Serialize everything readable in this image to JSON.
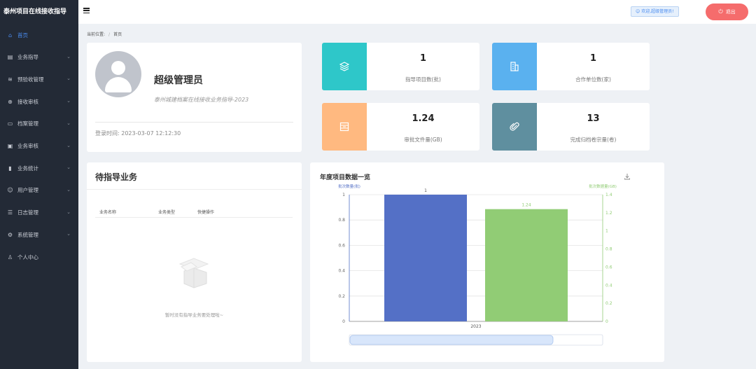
{
  "app": {
    "title": "泰州项目在线接收指导"
  },
  "sidebar": {
    "items": [
      {
        "label": "首页",
        "icon": "home-icon",
        "has_submenu": false,
        "active": true
      },
      {
        "label": "业务指导",
        "icon": "document-icon",
        "has_submenu": true
      },
      {
        "label": "预验收管理",
        "icon": "layers-icon",
        "has_submenu": true
      },
      {
        "label": "接收审核",
        "icon": "globe-icon",
        "has_submenu": true
      },
      {
        "label": "档案管理",
        "icon": "folder-icon",
        "has_submenu": true
      },
      {
        "label": "业务审核",
        "icon": "file-check-icon",
        "has_submenu": true
      },
      {
        "label": "业务统计",
        "icon": "bar-chart-icon",
        "has_submenu": true
      },
      {
        "label": "用户管理",
        "icon": "users-icon",
        "has_submenu": true
      },
      {
        "label": "日志管理",
        "icon": "log-icon",
        "has_submenu": true
      },
      {
        "label": "系统管理",
        "icon": "gear-icon",
        "has_submenu": true
      },
      {
        "label": "个人中心",
        "icon": "user-icon",
        "has_submenu": false
      }
    ]
  },
  "header": {
    "welcome": "欢迎,超级管理员!",
    "logout": "退出"
  },
  "breadcrumb": {
    "label": "当前位置:",
    "sep": "/",
    "current": "首页"
  },
  "profile": {
    "name": "超级管理员",
    "org": "泰州城建档案在线接收业务指导-2023",
    "login_time": "登录时间: 2023-03-07 12:12:30"
  },
  "stats": [
    {
      "value": "1",
      "label": "指导项目数(批)",
      "color": "#2ec7c9",
      "icon": "layers-icon"
    },
    {
      "value": "1",
      "label": "合作单位数(家)",
      "color": "#5ab1ef",
      "icon": "building-icon"
    },
    {
      "value": "1.24",
      "label": "审批文件量(GB)",
      "color": "#ffb980",
      "icon": "archive-icon"
    },
    {
      "value": "13",
      "label": "完成归档卷宗量(卷)",
      "color": "#5f8f9f",
      "icon": "paperclip-icon"
    }
  ],
  "pending": {
    "title": "待指导业务",
    "columns": [
      "业务名称",
      "业务类型",
      "快捷操作"
    ],
    "empty": "暂时没有指导业务要处理啦~"
  },
  "chart_data": {
    "type": "bar",
    "title": "年度项目数据一览",
    "categories": [
      "2023"
    ],
    "series": [
      {
        "name": "批次数量(批)",
        "values": [
          1
        ],
        "axis": "left",
        "color": "#5470c6",
        "label": "1"
      },
      {
        "name": "批次数据量(GB)",
        "values": [
          1.24
        ],
        "axis": "right",
        "color": "#91cc75",
        "label": "1.24"
      }
    ],
    "y_left": {
      "min": 0,
      "max": 1,
      "ticks": [
        "0",
        "0.2",
        "0.4",
        "0.6",
        "0.8",
        "1"
      ]
    },
    "y_right": {
      "min": 0,
      "max": 1.4,
      "ticks": [
        "0",
        "0.2",
        "0.4",
        "0.6",
        "0.8",
        "1",
        "1.2",
        "1.4"
      ]
    },
    "grid": true,
    "datazoom": true
  }
}
